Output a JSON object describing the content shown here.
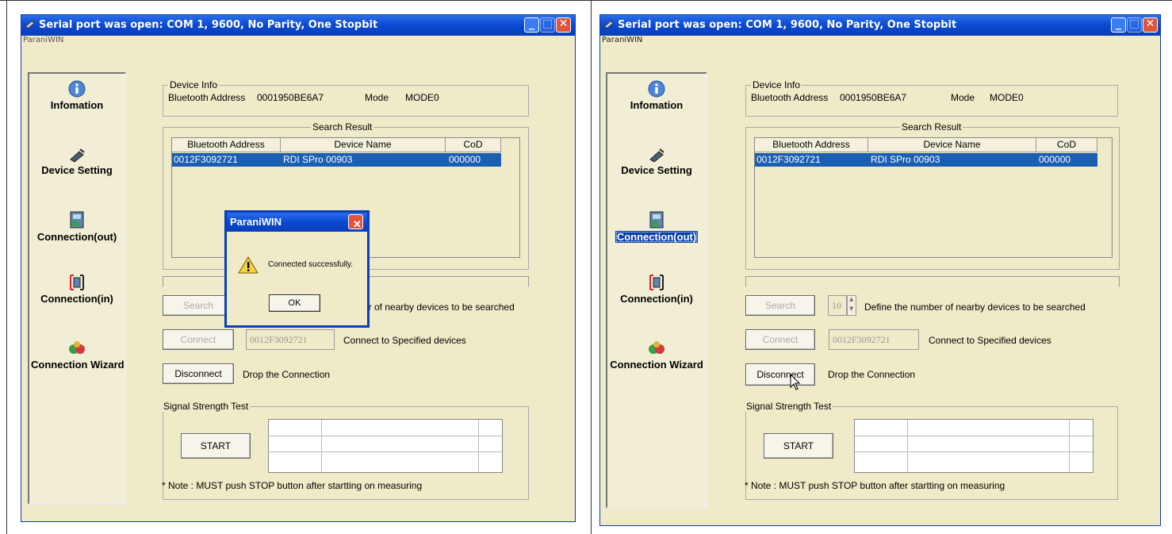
{
  "left": {
    "window_title": "Serial port was open: COM 1, 9600, No Parity, One Stopbit",
    "menu_label": "ParaniWIN",
    "sidebar": [
      {
        "label": "Infomation",
        "icon": "info-icon",
        "selected": false
      },
      {
        "label": "Device Setting",
        "icon": "device-icon",
        "selected": false
      },
      {
        "label": "Connection(out)",
        "icon": "connection-out-icon",
        "selected": false
      },
      {
        "label": "Connection(in)",
        "icon": "connection-in-icon",
        "selected": false
      },
      {
        "label": "Connection Wizard",
        "icon": "wizard-icon",
        "selected": false
      }
    ],
    "device_info": {
      "legend": "Device Info",
      "address_label": "Bluetooth Address",
      "address_value": "0001950BE6A7",
      "mode_label": "Mode",
      "mode_value": "MODE0"
    },
    "search_result": {
      "legend": "Search Result",
      "columns": [
        "Bluetooth Address",
        "Device Name",
        "CoD"
      ],
      "rows": [
        [
          "0012F3092721",
          "RDI SPro 00903",
          "000000"
        ]
      ]
    },
    "search_button": "Search",
    "search_desc_partial": "er of nearby devices to be searched",
    "connect_button": "Connect",
    "connect_address": "0012F3092721",
    "connect_desc": "Connect to Specified devices",
    "disconnect_button": "Disconnect",
    "disconnect_desc": "Drop the Connection",
    "signal": {
      "legend": "Signal Strength Test",
      "start_button": "START"
    },
    "note": "* Note : MUST push STOP button after startting on measuring",
    "dialog": {
      "title": "ParaniWIN",
      "message": "Connected successfully.",
      "ok_button": "OK"
    }
  },
  "right": {
    "window_title": "Serial port was open: COM 1, 9600, No Parity, One Stopbit",
    "menu_label": "ParaniWIN",
    "sidebar": [
      {
        "label": "Infomation",
        "icon": "info-icon",
        "selected": false
      },
      {
        "label": "Device Setting",
        "icon": "device-icon",
        "selected": false
      },
      {
        "label": "Connection(out)",
        "icon": "connection-out-icon",
        "selected": true
      },
      {
        "label": "Connection(in)",
        "icon": "connection-in-icon",
        "selected": false
      },
      {
        "label": "Connection Wizard",
        "icon": "wizard-icon",
        "selected": false
      }
    ],
    "device_info": {
      "legend": "Device Info",
      "address_label": "Bluetooth Address",
      "address_value": "0001950BE6A7",
      "mode_label": "Mode",
      "mode_value": "MODE0"
    },
    "search_result": {
      "legend": "Search Result",
      "columns": [
        "Bluetooth Address",
        "Device Name",
        "CoD"
      ],
      "rows": [
        [
          "0012F3092721",
          "RDI SPro 00903",
          "000000"
        ]
      ]
    },
    "search_button": "Search",
    "search_count": "10",
    "search_desc": "Define the number of nearby devices to be searched",
    "connect_button": "Connect",
    "connect_address": "0012F3092721",
    "connect_desc": "Connect to Specified devices",
    "disconnect_button": "Disconnect",
    "disconnect_desc": "Drop the Connection",
    "signal": {
      "legend": "Signal Strength Test",
      "start_button": "START"
    },
    "note": "* Note : MUST push STOP button after startting on measuring"
  },
  "colors": {
    "titlebar": "#0b48d0",
    "window_bg": "#efeac8",
    "selection": "#1b5fb0",
    "close_button": "#e0543a"
  }
}
